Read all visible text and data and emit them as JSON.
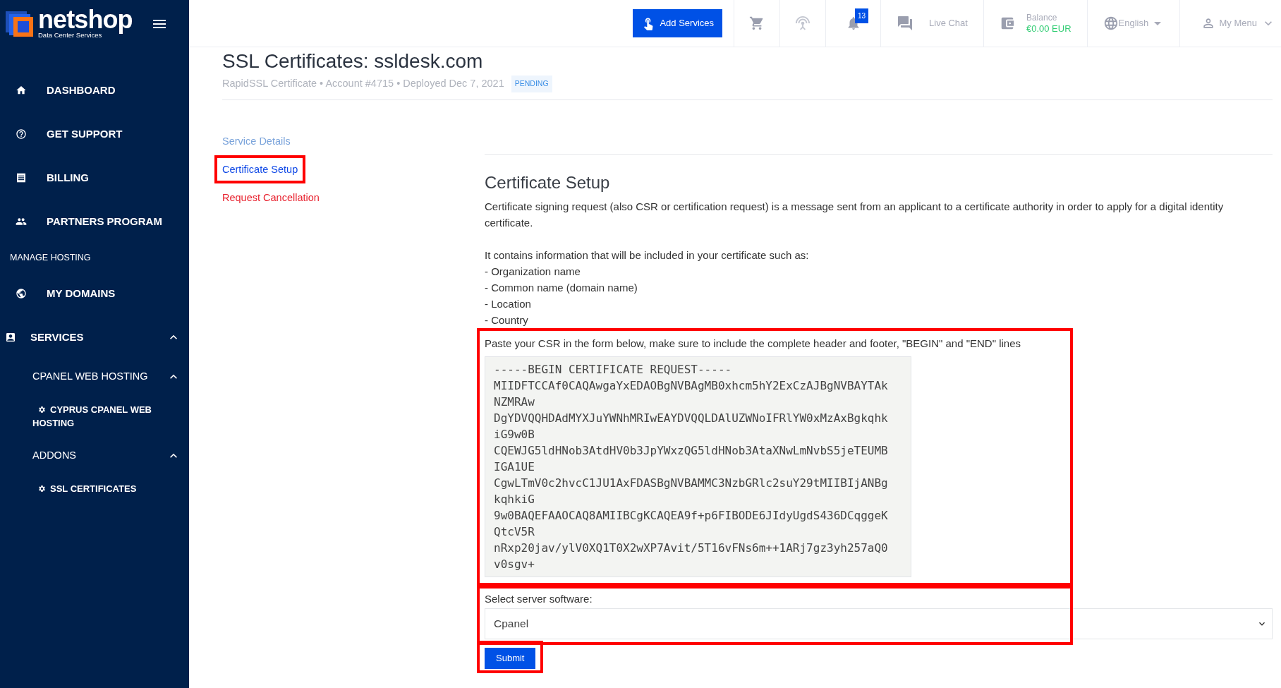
{
  "sidebar": {
    "brand": {
      "name": "netshop",
      "tagline": "Data Center Services"
    },
    "items": [
      {
        "kind": "item",
        "label": "DASHBOARD"
      },
      {
        "kind": "item",
        "label": "GET SUPPORT"
      },
      {
        "kind": "item",
        "label": "BILLING"
      },
      {
        "kind": "item",
        "label": "PARTNERS PROGRAM"
      },
      {
        "kind": "section",
        "label": "MANAGE HOSTING"
      },
      {
        "kind": "item",
        "label": "MY DOMAINS"
      },
      {
        "kind": "group",
        "label": "SERVICES",
        "expanded": true
      },
      {
        "kind": "subgroup",
        "label": "CPANEL WEB HOSTING",
        "expanded": true
      },
      {
        "kind": "leaf",
        "label": "CYPRUS CPANEL WEB HOSTING"
      },
      {
        "kind": "subgroup",
        "label": "ADDONS",
        "expanded": true
      },
      {
        "kind": "leaf",
        "label": "SSL CERTIFICATES"
      }
    ]
  },
  "header": {
    "add_services": "Add Services",
    "notifications": "13",
    "live_chat": "Live Chat",
    "balance": {
      "label": "Balance",
      "amount": "€0.00 EUR"
    },
    "language": "English",
    "user_menu": "My Menu"
  },
  "page": {
    "title": "SSL Certificates: ssldesk.com",
    "subtitle": "RapidSSL Certificate • Account #4715 • Deployed Dec 7, 2021",
    "status": "PENDING"
  },
  "service_nav": [
    {
      "label": "Service Details",
      "kind": "link",
      "selected": false,
      "annotated": false
    },
    {
      "label": "Certificate Setup",
      "kind": "link",
      "selected": true,
      "annotated": true
    },
    {
      "label": "Request Cancellation",
      "kind": "danger",
      "selected": false,
      "annotated": false
    }
  ],
  "setup": {
    "heading": "Certificate Setup",
    "intro": "Certificate signing request (also CSR or certification request) is a message sent from an applicant to a certificate authority in order to apply for a digital identity certificate.",
    "contains": "It contains information that will be included in your certificate such as:",
    "list": [
      "- Organization name",
      "- Common name (domain name)",
      "- Location",
      "- Country"
    ],
    "csr": {
      "annotated": true,
      "label": "Paste your CSR in the form below, make sure to include the complete header and footer, \"BEGIN\" and \"END\" lines",
      "lines": [
        "-----BEGIN CERTIFICATE REQUEST-----",
        "MIIDFTCCAf0CAQAwgaYxEDAOBgNVBAgMB0xhcm5hY2ExCzAJBgNVBAYTAkNZMRAw",
        "DgYDVQQHDAdMYXJuYWNhMRIwEAYDVQQLDAlUZWNoIFRlYW0xMzAxBgkqhkiG9w0B",
        "CQEWJG5ldHNob3AtdHV0b3JpYWxzQG5ldHNob3AtaXNwLmNvbS5jeTEUMBIGA1UE",
        "CgwLTmV0c2hvcC1JU1AxFDASBgNVBAMMC3NzbGRlc2suY29tMIIBIjANBgkqhkiG",
        "9w0BAQEFAAOCAQ8AMIIBCgKCAQEA9f+p6FIBODE6JIdyUgdS436DCqggeKQtcV5R",
        "nRxp20jav/ylV0XQ1T0X2wXP7Avit/5T16vFNs6m++1ARj7gz3yh257aQ0v0sgv+"
      ]
    },
    "server": {
      "annotated": true,
      "label": "Select server software:",
      "value": "Cpanel"
    },
    "submit": {
      "annotated": true,
      "label": "Submit"
    }
  }
}
